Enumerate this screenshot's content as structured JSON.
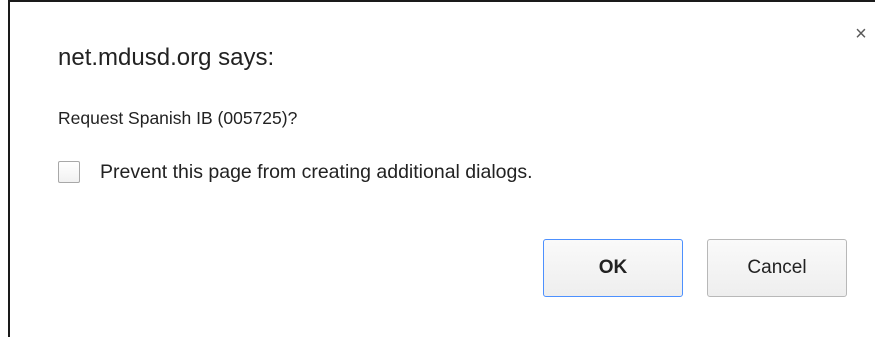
{
  "dialog": {
    "title": "net.mdusd.org says:",
    "message": "Request Spanish IB (005725)?",
    "checkbox_label": "Prevent this page from creating additional dialogs.",
    "checkbox_checked": false,
    "close_glyph": "×",
    "ok_label": "OK",
    "cancel_label": "Cancel"
  },
  "icons": {
    "close": "close-icon",
    "checkbox": "checkbox-unchecked"
  },
  "colors": {
    "ok_focus_border": "#4d90fe",
    "text": "#222222",
    "button_border": "#b8b8b8"
  }
}
